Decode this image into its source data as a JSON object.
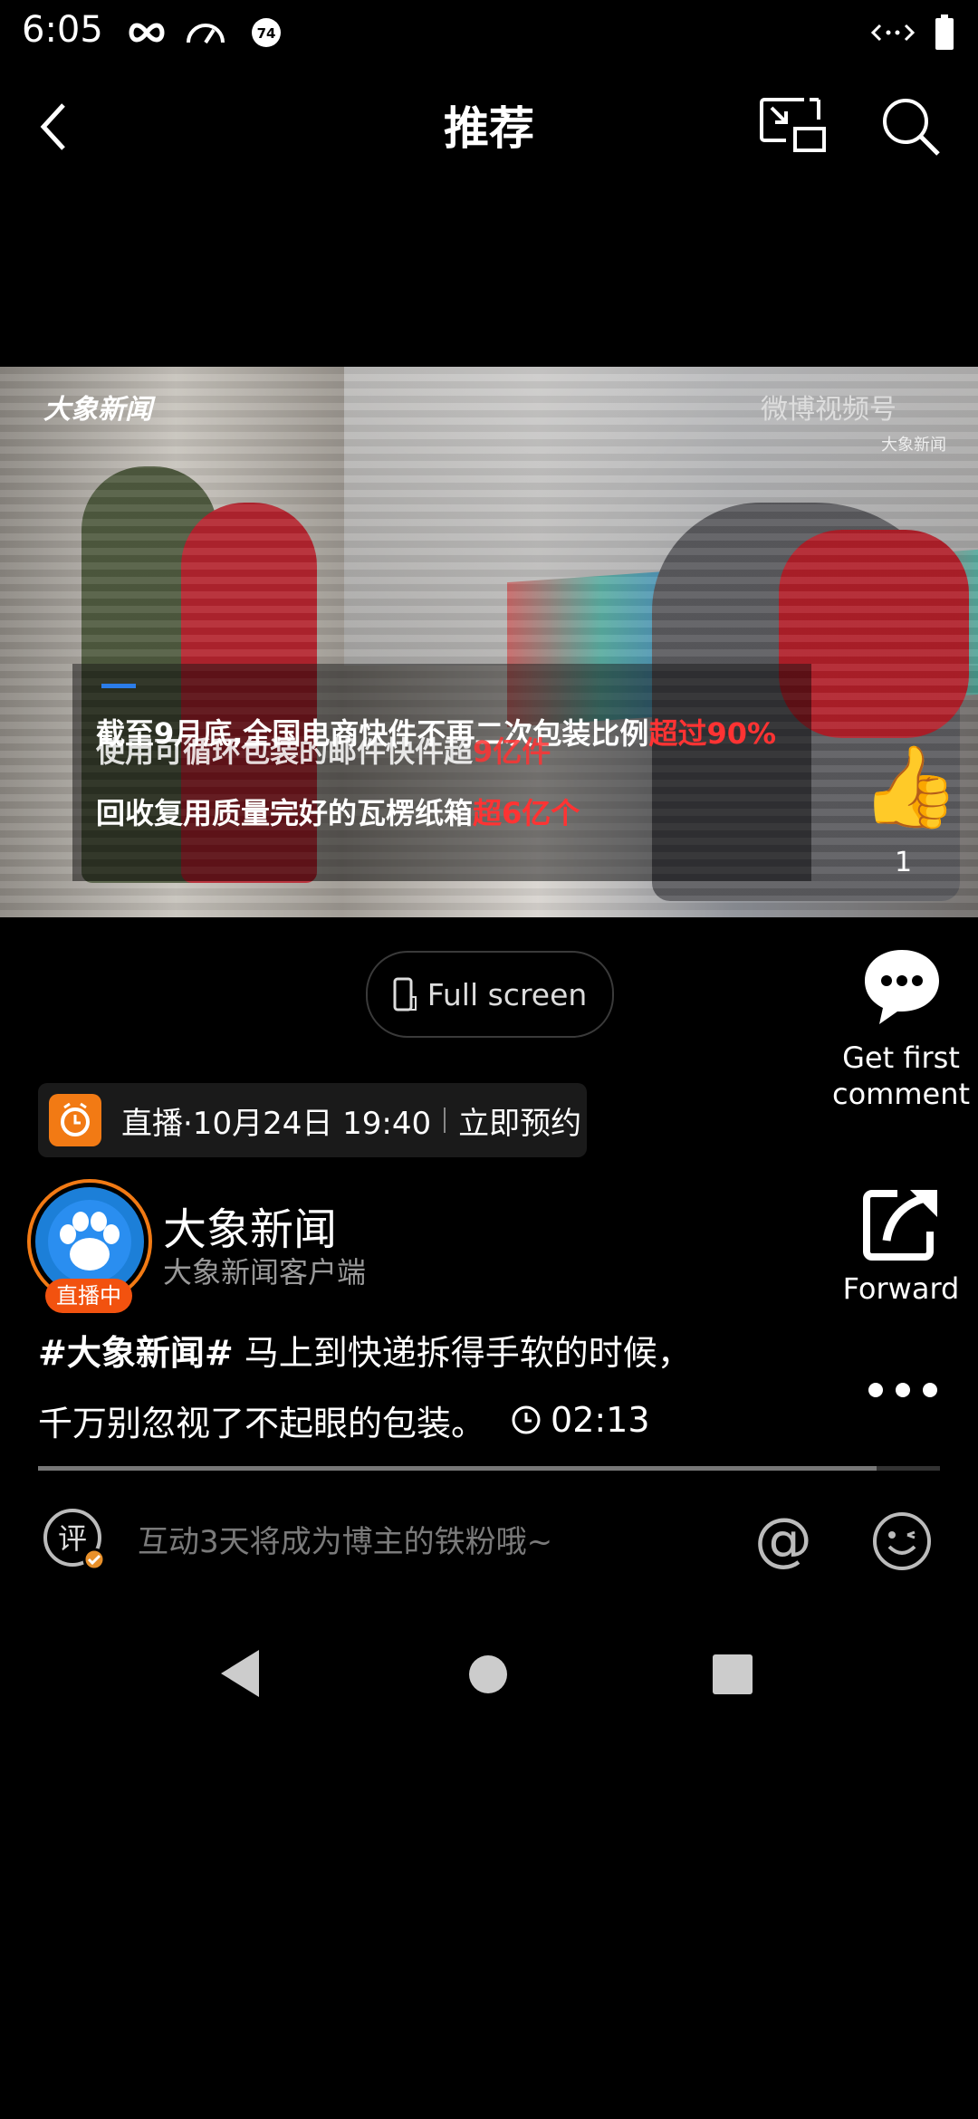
{
  "status_bar": {
    "time": "6:05",
    "icons": [
      "infinity-icon",
      "speedometer-icon",
      "notification-74-icon",
      "data-arrows-icon",
      "battery-icon"
    ],
    "badge_number": "74"
  },
  "nav": {
    "title": "推荐",
    "back_icon": "chevron-left-icon",
    "pip_icon": "picture-in-picture-icon",
    "search_icon": "search-icon"
  },
  "video": {
    "logo_left": "大象新闻",
    "logo_right": "微博视频号",
    "logo_right_sub": "大象新闻",
    "caption_line1_prefix": "截至9月底,全国电商快件不再二次包装比例",
    "caption_line1_accent": "超过90%",
    "caption_line2_prefix": "使用可循环包装的邮件快件超",
    "caption_line2_accent": "9亿件",
    "caption_line3_prefix": "回收复用质量完好的瓦楞纸箱",
    "caption_line3_accent": "超6亿个",
    "like_count": "1"
  },
  "actions": {
    "fullscreen_label": "Full screen",
    "comment_label": "Get first comment",
    "forward_label": "Forward"
  },
  "live_notice": {
    "text": "直播·10月24日 19:40",
    "reserve_label": "立即预约"
  },
  "account": {
    "name": "大象新闻",
    "subtitle": "大象新闻客户端",
    "live_badge": "直播中"
  },
  "post": {
    "hashtag": "#大象新闻#",
    "text_line1": " 马上到快递拆得手软的时候，",
    "text_line2": "千万别忽视了不起眼的包装。",
    "duration": "02:13",
    "progress_fraction": 0.93
  },
  "comment_bar": {
    "icon_label": "评",
    "placeholder": "互动3天将成为博主的铁粉哦~",
    "at_symbol": "@"
  },
  "system_nav": {
    "icons": [
      "back-triangle-icon",
      "home-circle-icon",
      "recents-square-icon"
    ]
  }
}
